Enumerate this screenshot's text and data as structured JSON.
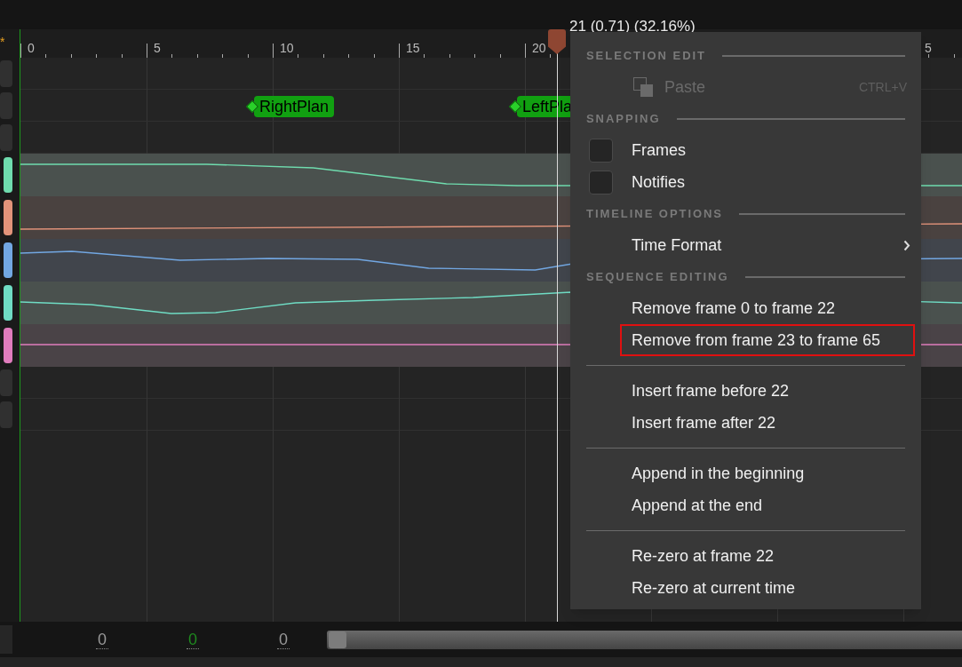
{
  "left_strip": {
    "modified_mark": "*"
  },
  "ruler": {
    "labels": [
      "0",
      "5",
      "10",
      "15",
      "20"
    ],
    "cut_label": "5"
  },
  "playhead": {
    "label": "21 (0.71) (32.16%)"
  },
  "notifies": [
    {
      "name": "RightPlan"
    },
    {
      "name": "LeftPla"
    }
  ],
  "tracks": [
    {
      "color": "#6fdcae"
    },
    {
      "color": "#e2937a"
    },
    {
      "color": "#72a7e2"
    },
    {
      "color": "#6fdcc4"
    },
    {
      "color": "#e07cbd"
    }
  ],
  "menu": {
    "sections": [
      {
        "title": "SELECTION EDIT",
        "groups": [
          [
            {
              "kind": "action",
              "label": "Paste",
              "shortcut": "CTRL+V",
              "disabled": true,
              "highlighted": false
            }
          ]
        ]
      },
      {
        "title": "SNAPPING",
        "groups": [
          [
            {
              "kind": "checkbox",
              "label": "Frames",
              "checked": false
            },
            {
              "kind": "checkbox",
              "label": "Notifies",
              "checked": false
            }
          ]
        ]
      },
      {
        "title": "TIMELINE OPTIONS",
        "groups": [
          [
            {
              "kind": "submenu",
              "label": "Time Format"
            }
          ]
        ]
      },
      {
        "title": "SEQUENCE EDITING",
        "groups": [
          [
            {
              "kind": "action",
              "label": "Remove frame 0 to frame 22",
              "disabled": false,
              "highlighted": false
            },
            {
              "kind": "action",
              "label": "Remove from frame 23 to frame 65",
              "disabled": false,
              "highlighted": true
            }
          ],
          [
            {
              "kind": "action",
              "label": "Insert frame before 22",
              "disabled": false,
              "highlighted": false
            },
            {
              "kind": "action",
              "label": "Insert frame after 22",
              "disabled": false,
              "highlighted": false
            }
          ],
          [
            {
              "kind": "action",
              "label": "Append in the beginning",
              "disabled": false,
              "highlighted": false
            },
            {
              "kind": "action",
              "label": "Append at the end",
              "disabled": false,
              "highlighted": false
            }
          ],
          [
            {
              "kind": "action",
              "label": "Re-zero at frame 22",
              "disabled": false,
              "highlighted": false
            },
            {
              "kind": "action",
              "label": "Re-zero at current time",
              "disabled": false,
              "highlighted": false
            }
          ]
        ]
      }
    ]
  },
  "bottom_bar": {
    "fields": [
      {
        "value": "0",
        "color": "#9a9a9a"
      },
      {
        "value": "0",
        "color": "#1f8a1f"
      },
      {
        "value": "0",
        "color": "#9a9a9a"
      }
    ]
  }
}
